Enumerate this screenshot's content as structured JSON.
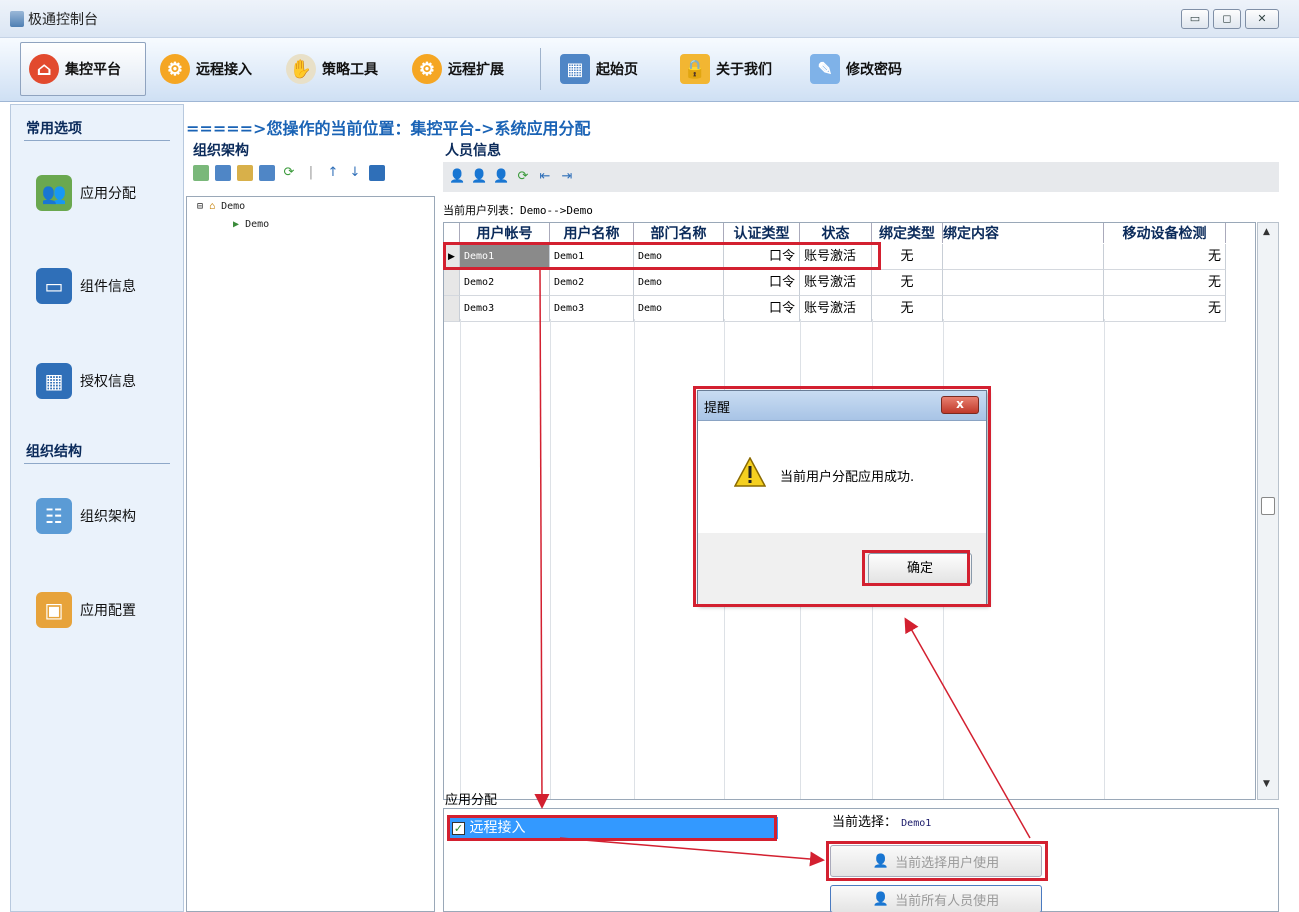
{
  "window": {
    "title": "极通控制台",
    "buttons": [
      "▭",
      "◻",
      "✕"
    ]
  },
  "toolbar": {
    "items": [
      {
        "label": "集控平台",
        "icon": "house-icon"
      },
      {
        "label": "远程接入",
        "icon": "gear-icon"
      },
      {
        "label": "策略工具",
        "icon": "tool-icon"
      },
      {
        "label": "远程扩展",
        "icon": "gear-icon"
      },
      {
        "label": "起始页",
        "icon": "home-page-icon"
      },
      {
        "label": "关于我们",
        "icon": "lock-icon"
      },
      {
        "label": "修改密码",
        "icon": "edit-icon"
      }
    ]
  },
  "sidebar": {
    "section1": "常用选项",
    "items1": [
      {
        "label": "应用分配"
      },
      {
        "label": "组件信息"
      },
      {
        "label": "授权信息"
      }
    ],
    "section2": "组织结构",
    "items2": [
      {
        "label": "组织架构"
      },
      {
        "label": "应用配置"
      }
    ]
  },
  "location": "=====>您操作的当前位置：集控平台->系统应用分配",
  "org": {
    "title": "组织架构",
    "tree_root": "Demo",
    "tree_child": "Demo"
  },
  "people": {
    "title": "人员信息",
    "user_list": "当前用户列表：Demo-->Demo",
    "columns": [
      "用户帐号",
      "用户名称",
      "部门名称",
      "认证类型",
      "状态",
      "绑定类型",
      "绑定内容",
      "移动设备检测"
    ],
    "rows": [
      [
        "Demo1",
        "Demo1",
        "Demo",
        "口令",
        "账号激活",
        "无",
        "",
        "无"
      ],
      [
        "Demo2",
        "Demo2",
        "Demo",
        "口令",
        "账号激活",
        "无",
        "",
        "无"
      ],
      [
        "Demo3",
        "Demo3",
        "Demo",
        "口令",
        "账号激活",
        "无",
        "",
        "无"
      ]
    ]
  },
  "app": {
    "title": "应用分配",
    "item": "远程接入",
    "current_label": "当前选择：",
    "current_value": "Demo1",
    "btn_current": "当前选择用户使用",
    "btn_all": "当前所有人员使用"
  },
  "dialog": {
    "title": "提醒",
    "message": "当前用户分配应用成功.",
    "ok": "确定",
    "close": "x"
  },
  "colors": {
    "accent": "#1a63b5",
    "highlight_red": "#d32030",
    "selected_blue": "#3399ff"
  }
}
